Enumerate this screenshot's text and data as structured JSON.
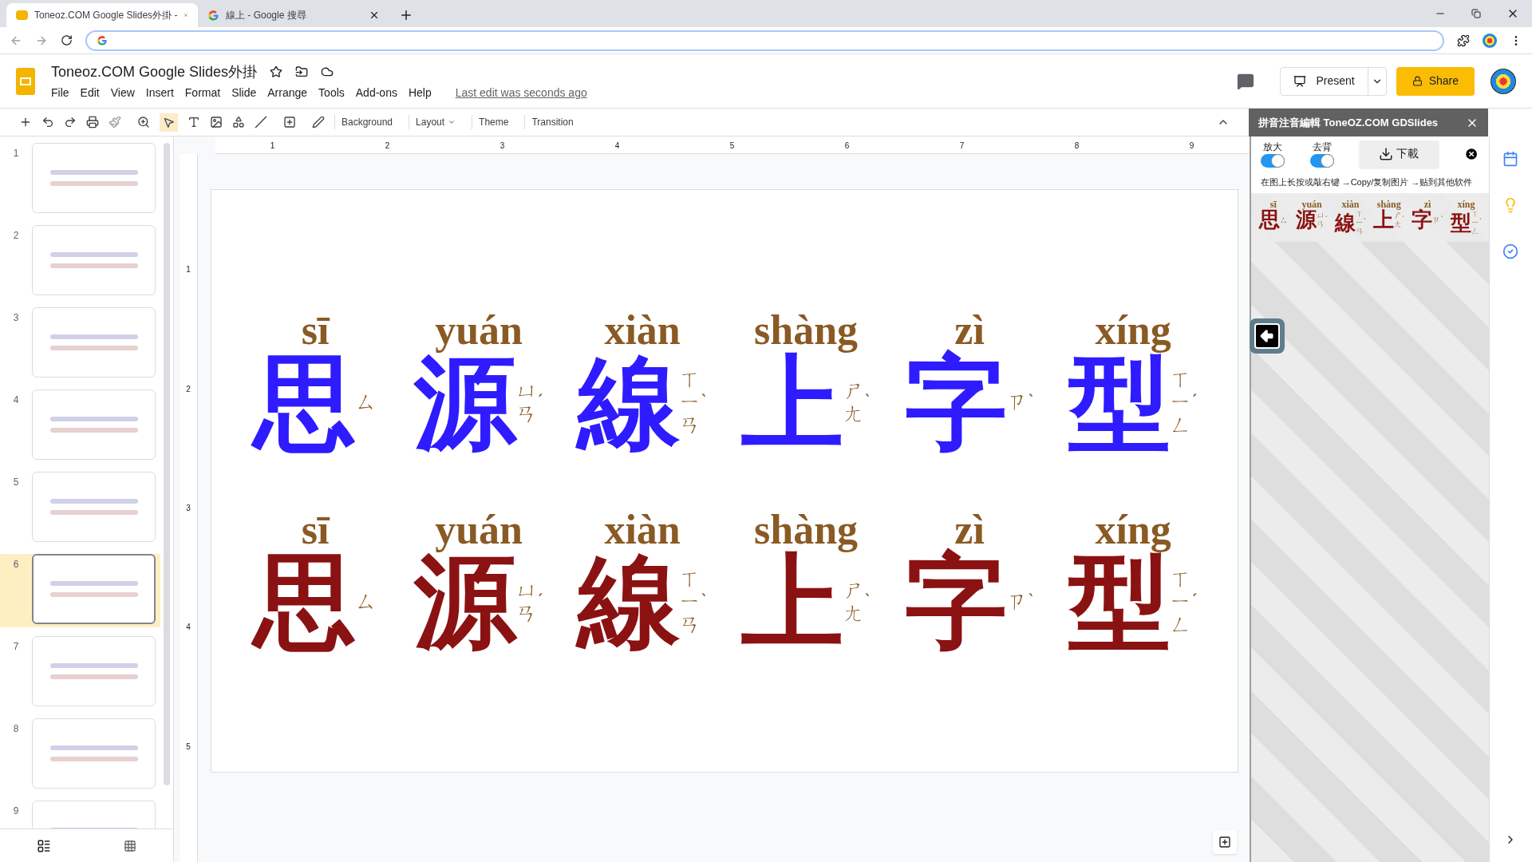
{
  "browser": {
    "tabs": [
      {
        "title": "Toneoz.COM Google Slides外掛 -",
        "kind": "slides",
        "selected": true
      },
      {
        "title": "線上 - Google 搜尋",
        "kind": "google",
        "selected": false
      }
    ]
  },
  "doc": {
    "title": "Toneoz.COM Google Slides外掛",
    "menu": [
      "File",
      "Edit",
      "View",
      "Insert",
      "Format",
      "Slide",
      "Arrange",
      "Tools",
      "Add-ons",
      "Help"
    ],
    "last_edit": "Last edit was seconds ago",
    "present": "Present",
    "share": "Share"
  },
  "toolbar": {
    "buttons": [
      {
        "label": "Background",
        "caret": false
      },
      {
        "label": "Layout",
        "caret": true
      },
      {
        "label": "Theme",
        "caret": false
      },
      {
        "label": "Transition",
        "caret": false
      }
    ]
  },
  "filmstrip": [
    {
      "number": "1",
      "selected": false
    },
    {
      "number": "2",
      "selected": false
    },
    {
      "number": "3",
      "selected": false
    },
    {
      "number": "4",
      "selected": false
    },
    {
      "number": "5",
      "selected": false
    },
    {
      "number": "6",
      "selected": true
    },
    {
      "number": "7",
      "selected": false
    },
    {
      "number": "8",
      "selected": false
    },
    {
      "number": "9",
      "selected": false
    }
  ],
  "ruler": {
    "horizontal": [
      "1",
      "2",
      "3",
      "4",
      "5",
      "6",
      "7",
      "8",
      "9"
    ],
    "vertical": [
      "1",
      "2",
      "3",
      "4",
      "5"
    ]
  },
  "slide": {
    "rows": [
      {
        "kind": "serif",
        "color": "#2f1bff",
        "chars": [
          {
            "char": "思",
            "pinyin": "sī",
            "zhuyin": "ㄙ"
          },
          {
            "char": "源",
            "pinyin": "yuán",
            "zhuyin": "ㄩㄢ",
            "tone": "ˊ"
          },
          {
            "char": "線",
            "pinyin": "xiàn",
            "zhuyin": "ㄒㄧㄢ",
            "tone": "ˋ"
          },
          {
            "char": "上",
            "pinyin": "shàng",
            "zhuyin": "ㄕㄤ",
            "tone": "ˋ"
          },
          {
            "char": "字",
            "pinyin": "zì",
            "zhuyin": "ㄗ",
            "tone": "ˋ"
          },
          {
            "char": "型",
            "pinyin": "xíng",
            "zhuyin": "ㄒㄧㄥ",
            "tone": "ˊ"
          }
        ]
      },
      {
        "kind": "bold",
        "color": "#8b1212",
        "chars": [
          {
            "char": "思",
            "pinyin": "sī",
            "zhuyin": "ㄙ"
          },
          {
            "char": "源",
            "pinyin": "yuán",
            "zhuyin": "ㄩㄢ",
            "tone": "ˊ"
          },
          {
            "char": "線",
            "pinyin": "xiàn",
            "zhuyin": "ㄒㄧㄢ",
            "tone": "ˋ"
          },
          {
            "char": "上",
            "pinyin": "shàng",
            "zhuyin": "ㄕㄤ",
            "tone": "ˋ"
          },
          {
            "char": "字",
            "pinyin": "zì",
            "zhuyin": "ㄗ",
            "tone": "ˋ"
          },
          {
            "char": "型",
            "pinyin": "xíng",
            "zhuyin": "ㄒㄧㄥ",
            "tone": "ˊ"
          }
        ]
      }
    ]
  },
  "panel": {
    "title": "拼音注音編輯 ToneOZ.COM GDSlides",
    "toggles": [
      {
        "label": "放大",
        "on": true
      },
      {
        "label": "去背",
        "on": true
      }
    ],
    "download": "下載",
    "hint": "在图上长按或敲右键 →Copy/复制图片 →贴到其他软件",
    "preview": [
      {
        "char": "思",
        "pinyin": "sī",
        "zhuyin": "ㄙ"
      },
      {
        "char": "源",
        "pinyin": "yuán",
        "zhuyin": "ㄩㄢ",
        "tone": "ˊ"
      },
      {
        "char": "線",
        "pinyin": "xiàn",
        "zhuyin": "ㄒㄧㄢ",
        "tone": "ˋ"
      },
      {
        "char": "上",
        "pinyin": "shàng",
        "zhuyin": "ㄕㄤ",
        "tone": "ˋ"
      },
      {
        "char": "字",
        "pinyin": "zì",
        "zhuyin": "ㄗ",
        "tone": "ˋ"
      },
      {
        "char": "型",
        "pinyin": "xíng",
        "zhuyin": "ㄒㄧㄥ",
        "tone": "ˊ"
      }
    ]
  }
}
